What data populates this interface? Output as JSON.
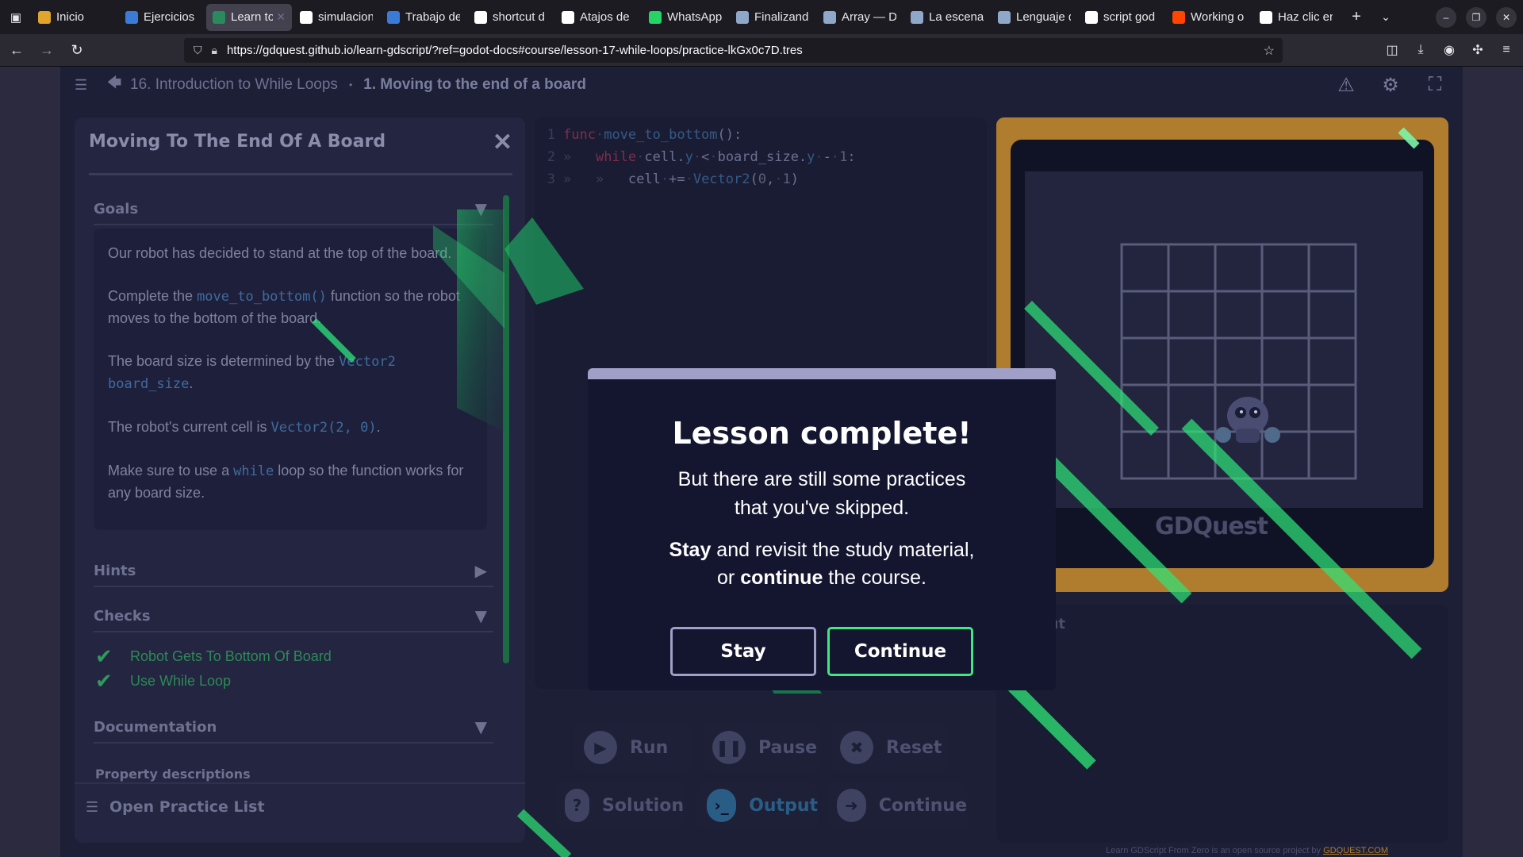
{
  "browser": {
    "tabs": [
      {
        "label": "Inicio",
        "fav_color": "#e0a52b",
        "active": false
      },
      {
        "label": "Ejercicios",
        "fav_color": "#3b7bd6",
        "active": false
      },
      {
        "label": "Learn to",
        "fav_color": "#2a8a5d",
        "active": true
      },
      {
        "label": "simulacion",
        "fav_color": "#ffffff",
        "active": false
      },
      {
        "label": "Trabajo de",
        "fav_color": "#3b7bd6",
        "active": false
      },
      {
        "label": "shortcut d",
        "fav_color": "#ffffff",
        "active": false
      },
      {
        "label": "Atajos de",
        "fav_color": "#ffffff",
        "active": false
      },
      {
        "label": "WhatsApp",
        "fav_color": "#25d366",
        "active": false
      },
      {
        "label": "Finalizand",
        "fav_color": "#8fa7c8",
        "active": false
      },
      {
        "label": "Array — D",
        "fav_color": "#8fa7c8",
        "active": false
      },
      {
        "label": "La escena",
        "fav_color": "#8fa7c8",
        "active": false
      },
      {
        "label": "Lenguaje d",
        "fav_color": "#8fa7c8",
        "active": false
      },
      {
        "label": "script god",
        "fav_color": "#ffffff",
        "active": false
      },
      {
        "label": "Working o",
        "fav_color": "#ff4500",
        "active": false
      },
      {
        "label": "Haz clic en",
        "fav_color": "#ffffff",
        "active": false
      }
    ],
    "url": "https://gdquest.github.io/learn-gdscript/?ref=godot-docs#course/lesson-17-while-loops/practice-lkGx0c7D.tres"
  },
  "breadcrumb": {
    "lesson": "16. Introduction to While Loops",
    "separator": "•",
    "current": "1. Moving to the end of a board"
  },
  "panel": {
    "title": "Moving To The End Of A Board",
    "goals_label": "Goals",
    "goals": {
      "p1": "Our robot has decided to stand at the top of the board.",
      "p2_a": "Complete the ",
      "p2_code": "move_to_bottom()",
      "p2_b": " function so the robot moves to the bottom of the board.",
      "p3_a": "The board size is determined by the ",
      "p3_code": "Vector2 board_size",
      "p3_b": ".",
      "p4_a": "The robot's current cell is ",
      "p4_code": "Vector2(2, 0)",
      "p4_b": ".",
      "p5_a": "Make sure to use a ",
      "p5_code": "while",
      "p5_b": " loop so the function works for any board size."
    },
    "hints_label": "Hints",
    "checks_label": "Checks",
    "checks": [
      "Robot Gets To Bottom Of Board",
      "Use While Loop"
    ],
    "documentation_label": "Documentation",
    "property_descriptions": "Property descriptions",
    "open_practice_list": "Open Practice List"
  },
  "editor": {
    "lines": [
      {
        "n": "1",
        "parts": [
          [
            "kw",
            "func"
          ],
          [
            "ws",
            "·"
          ],
          [
            "fn",
            "move_to_bottom"
          ],
          [
            "tx",
            "():"
          ]
        ]
      },
      {
        "n": "2",
        "parts": [
          [
            "ws",
            "»   "
          ],
          [
            "kw",
            "while"
          ],
          [
            "ws",
            "·"
          ],
          [
            "tx",
            "cell."
          ],
          [
            "fn",
            "y"
          ],
          [
            "ws",
            "·"
          ],
          [
            "tx",
            "<"
          ],
          [
            "ws",
            "·"
          ],
          [
            "tx",
            "board_size."
          ],
          [
            "fn",
            "y"
          ],
          [
            "ws",
            "·"
          ],
          [
            "tx",
            "-"
          ],
          [
            "ws",
            "·"
          ],
          [
            "nu",
            "1"
          ],
          [
            "tx",
            ":"
          ]
        ]
      },
      {
        "n": "3",
        "parts": [
          [
            "ws",
            "»   »   "
          ],
          [
            "tx",
            "cell"
          ],
          [
            "ws",
            "·"
          ],
          [
            "tx",
            "+="
          ],
          [
            "ws",
            "·"
          ],
          [
            "fn",
            "Vector2"
          ],
          [
            "tx",
            "("
          ],
          [
            "nu",
            "0"
          ],
          [
            "tx",
            ","
          ],
          [
            "ws",
            "·"
          ],
          [
            "nu",
            "1"
          ],
          [
            "tx",
            ")"
          ]
        ]
      }
    ]
  },
  "viewport": {
    "logo": "GDQuest",
    "grid_cols": 5,
    "grid_rows": 5
  },
  "output_label": "Output",
  "buttons": {
    "run": "Run",
    "pause": "Pause",
    "reset": "Reset",
    "solution": "Solution",
    "output": "Output",
    "continue": "Continue"
  },
  "modal": {
    "title": "Lesson complete!",
    "body_line1": "But there are still some practices",
    "body_line2": "that you've skipped.",
    "stay_word": "Stay",
    "body2_a": " and revisit the study material,",
    "body2_b": "or ",
    "continue_word": "continue",
    "body2_c": " the course.",
    "stay_button": "Stay",
    "continue_button": "Continue"
  },
  "footer": {
    "note": "Learn GDScript From Zero is an open source project by ",
    "link": "GDQUEST.COM"
  },
  "colors": {
    "accent_green": "#3ee882",
    "modal_header": "#a09fc7",
    "viewport_frame": "#b07c2e"
  }
}
